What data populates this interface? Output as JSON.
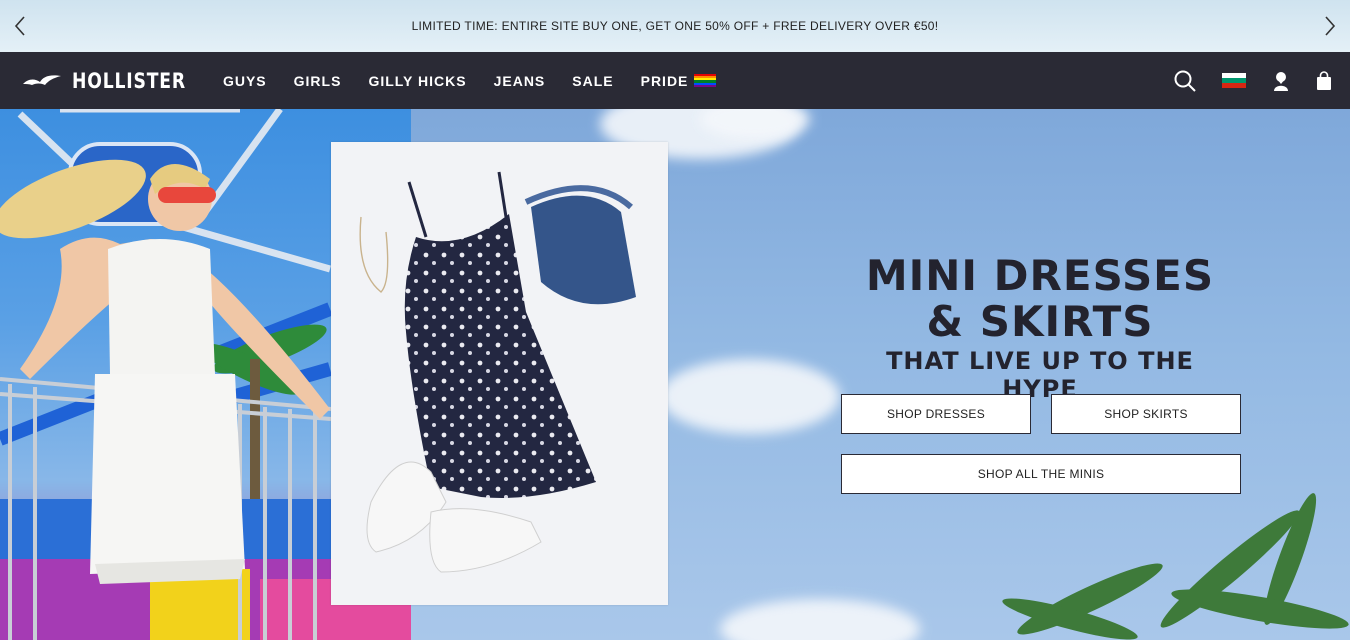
{
  "promo": {
    "text": "LIMITED TIME: ENTIRE SITE BUY ONE, GET ONE 50% OFF + FREE DELIVERY OVER €50!",
    "prev_icon": "chevron-left-icon",
    "next_icon": "chevron-right-icon"
  },
  "nav": {
    "brand": "HOLLISTER",
    "logo_icon": "seagull-icon",
    "links": [
      "GUYS",
      "GIRLS",
      "GILLY HICKS",
      "JEANS",
      "SALE",
      "PRIDE"
    ],
    "pride_icon": "rainbow-flag-icon",
    "right_icons": [
      "search-icon",
      "bulgaria-flag-icon",
      "account-icon",
      "shopping-bag-icon"
    ],
    "colors": {
      "background": "#2a2a35",
      "text": "#ffffff"
    }
  },
  "hero": {
    "headline_line1": "MINI DRESSES",
    "headline_line2": "& SKIRTS",
    "subheadline": "THAT LIVE UP TO THE HYPE",
    "buttons": {
      "shop_dresses": "SHOP DRESSES",
      "shop_skirts": "SHOP SKIRTS",
      "shop_all": "SHOP ALL THE MINIS"
    }
  }
}
